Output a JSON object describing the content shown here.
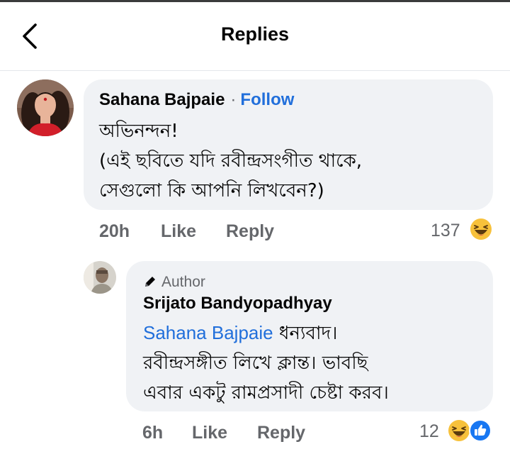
{
  "header": {
    "title": "Replies"
  },
  "comment": {
    "author": "Sahana Bajpaie",
    "separator": "·",
    "follow_label": "Follow",
    "text": "অভিনন্দন!\n(এই ছবিতে যদি রবীন্দ্রসংগীত থাকে,\nসেগুলো কি আপনি লিখবেন?)",
    "time": "20h",
    "like_label": "Like",
    "reply_label": "Reply",
    "reaction_count": "137",
    "reaction_icon": "haha-emoji-icon"
  },
  "reply": {
    "badge_label": "Author",
    "author": "Srijato Bandyopadhyay",
    "mention": "Sahana Bajpaie",
    "text_first": " ধন্যবাদ।",
    "text_rest": "রবীন্দ্রসঙ্গীত লিখে ক্লান্ত। ভাবছি\nএবার একটু রামপ্রসাদী চেষ্টা করব।",
    "time": "6h",
    "like_label": "Like",
    "reply_label": "Reply",
    "reaction_count": "12",
    "reaction_icons": [
      "haha-emoji-icon",
      "like-icon"
    ]
  },
  "colors": {
    "link": "#216fdb",
    "bubble": "#f0f2f5",
    "meta": "#65676b"
  }
}
